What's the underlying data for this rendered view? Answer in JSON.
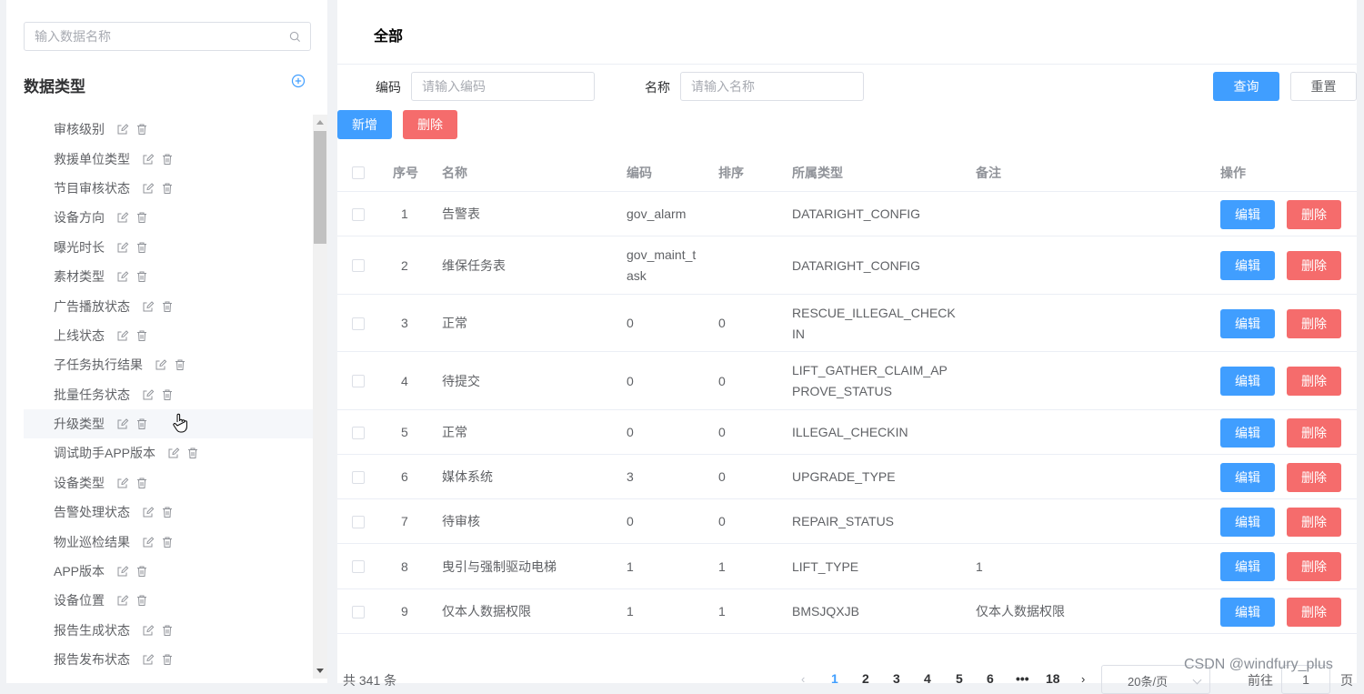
{
  "sidebar": {
    "search_placeholder": "输入数据名称",
    "title": "数据类型",
    "items": [
      {
        "label": "审核级别"
      },
      {
        "label": "救援单位类型"
      },
      {
        "label": "节目审核状态"
      },
      {
        "label": "设备方向"
      },
      {
        "label": "曝光时长"
      },
      {
        "label": "素材类型"
      },
      {
        "label": "广告播放状态"
      },
      {
        "label": "上线状态"
      },
      {
        "label": "子任务执行结果"
      },
      {
        "label": "批量任务状态"
      },
      {
        "label": "升级类型"
      },
      {
        "label": "调试助手APP版本"
      },
      {
        "label": "设备类型"
      },
      {
        "label": "告警处理状态"
      },
      {
        "label": "物业巡检结果"
      },
      {
        "label": "APP版本"
      },
      {
        "label": "设备位置"
      },
      {
        "label": "报告生成状态"
      },
      {
        "label": "报告发布状态"
      }
    ]
  },
  "main": {
    "title": "全部",
    "filters": {
      "code_label": "编码",
      "code_placeholder": "请输入编码",
      "name_label": "名称",
      "name_placeholder": "请输入名称",
      "query_button": "查询",
      "reset_button": "重置"
    },
    "actions": {
      "add_button": "新增",
      "delete_button": "删除"
    },
    "table": {
      "columns": {
        "index": "序号",
        "name": "名称",
        "code": "编码",
        "sort": "排序",
        "type": "所属类型",
        "remark": "备注",
        "ops": "操作"
      },
      "edit_label": "编辑",
      "delete_label": "删除",
      "rows": [
        {
          "index": "1",
          "name": "告警表",
          "code": "gov_alarm",
          "sort": "",
          "type": "DATARIGHT_CONFIG",
          "remark": ""
        },
        {
          "index": "2",
          "name": "维保任务表",
          "code": "gov_maint_task",
          "sort": "",
          "type": "DATARIGHT_CONFIG",
          "remark": ""
        },
        {
          "index": "3",
          "name": "正常",
          "code": "0",
          "sort": "0",
          "type": "RESCUE_ILLEGAL_CHECKIN",
          "remark": ""
        },
        {
          "index": "4",
          "name": "待提交",
          "code": "0",
          "sort": "0",
          "type": "LIFT_GATHER_CLAIM_APPROVE_STATUS",
          "remark": ""
        },
        {
          "index": "5",
          "name": "正常",
          "code": "0",
          "sort": "0",
          "type": "ILLEGAL_CHECKIN",
          "remark": ""
        },
        {
          "index": "6",
          "name": "媒体系统",
          "code": "3",
          "sort": "0",
          "type": "UPGRADE_TYPE",
          "remark": ""
        },
        {
          "index": "7",
          "name": "待审核",
          "code": "0",
          "sort": "0",
          "type": "REPAIR_STATUS",
          "remark": ""
        },
        {
          "index": "8",
          "name": "曳引与强制驱动电梯",
          "code": "1",
          "sort": "1",
          "type": "LIFT_TYPE",
          "remark": "1"
        },
        {
          "index": "9",
          "name": "仅本人数据权限",
          "code": "1",
          "sort": "1",
          "type": "BMSJQXJB",
          "remark": "仅本人数据权限"
        }
      ]
    },
    "pagination": {
      "total": "共 341 条",
      "pages": [
        "1",
        "2",
        "3",
        "4",
        "5",
        "6",
        "•••",
        "18"
      ],
      "current_page": "1",
      "page_size": "20条/页",
      "goto_label": "前往",
      "goto_value": "1",
      "goto_suffix": "页"
    }
  },
  "watermark": "CSDN @windfury_plus",
  "colors": {
    "primary": "#409eff",
    "danger": "#f56c6c",
    "border": "#dcdfe6"
  }
}
